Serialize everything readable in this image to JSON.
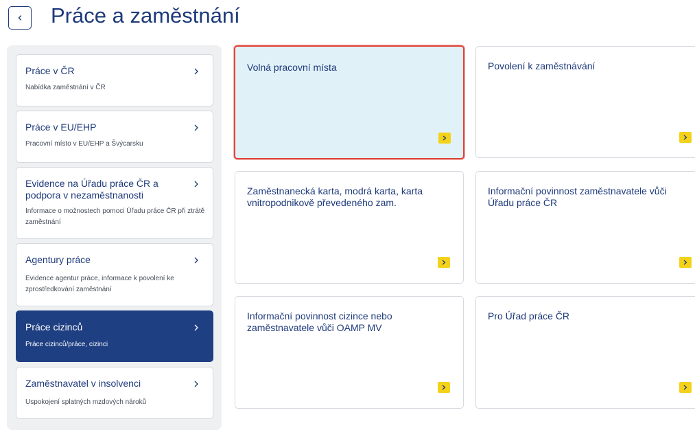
{
  "header": {
    "title": "Práce a zaměstnání",
    "back_icon": "chevron-left-icon"
  },
  "sidebar": {
    "items": [
      {
        "title": "Práce v ČR",
        "subtitle": "Nabídka zaměstnání v ČR",
        "active": false
      },
      {
        "title": "Práce v EU/EHP",
        "subtitle": "Pracovní místo v EU/EHP a Švýcarsku",
        "active": false
      },
      {
        "title": "Evidence na Úřadu práce ČR a podpora v nezaměstnanosti",
        "subtitle": "Informace o možnostech pomoci Úřadu práce ČR při ztrátě zaměstnání",
        "active": false
      },
      {
        "title": "Agentury práce",
        "subtitle": "Evidence agentur práce, informace k povolení ke zprostředkování zaměstnání",
        "active": false
      },
      {
        "title": "Práce cizinců",
        "subtitle": "Práce cizinců/práce, cizinci",
        "active": true
      },
      {
        "title": "Zaměstnavatel v insolvenci",
        "subtitle": "Uspokojení splatných mzdových nároků",
        "active": false
      }
    ]
  },
  "tiles": [
    {
      "title": "Volná pracovní místa",
      "selected": true
    },
    {
      "title": "Povolení k zaměstnávání",
      "selected": false
    },
    {
      "title": "Zaměstnanecká karta, modrá karta, karta vnitropodnikově převedeného zam.",
      "selected": false
    },
    {
      "title": "Informační povinnost zaměstnavatele vůči Úřadu práce ČR",
      "selected": false
    },
    {
      "title": "Informační povinnost cizince nebo zaměstnavatele vůči OAMP MV",
      "selected": false
    },
    {
      "title": "Pro Úřad práce ČR",
      "selected": false
    }
  ],
  "colors": {
    "primary": "#1e3a7b",
    "active_bg": "#1e3f82",
    "accent_yellow": "#f5d21a",
    "selected_bg": "#e1f1f8",
    "selected_border": "#e0443a"
  }
}
